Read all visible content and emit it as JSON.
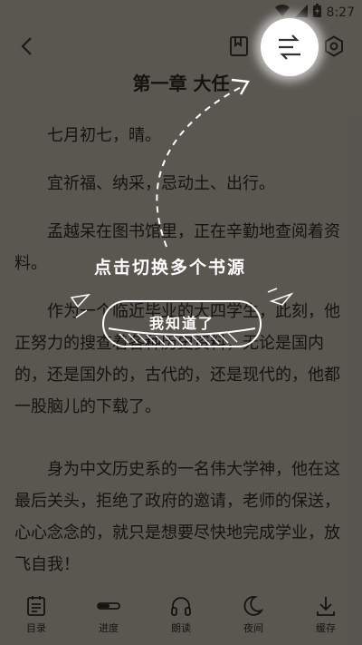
{
  "status_bar": {
    "time": "8:27"
  },
  "chapter": {
    "title": "第一章 大任",
    "paragraphs": [
      "七月初七，晴。",
      "宜祈福、纳采，忌动土、出行。",
      "孟越呆在图书馆里，正在辛勤地查阅着资料。",
      "作为一个临近毕业的大四学生，此刻，他正努力的搜查着各种历史资料，无论是国内的，还是国外的，古代的，还是现代的，他都一股脑儿的下载了。",
      "身为中文历史系的一名伟大学神，他在这最后关头，拒绝了政府的邀请，老师的保送，心心念念的，就只是想要尽快地完成学业，放飞自我！"
    ]
  },
  "bottom_nav": {
    "items": [
      {
        "label": "目录",
        "icon": "catalog-icon"
      },
      {
        "label": "进度",
        "icon": "progress-icon"
      },
      {
        "label": "朗读",
        "icon": "headphones-icon"
      },
      {
        "label": "夜间",
        "icon": "moon-icon"
      },
      {
        "label": "缓存",
        "icon": "download-icon"
      }
    ]
  },
  "guide": {
    "hint": "点击切换多个书源",
    "button_label": "我知道了"
  },
  "colors": {
    "page_background": "#e9e6df",
    "overlay": "rgba(15,12,8,0.66)"
  }
}
